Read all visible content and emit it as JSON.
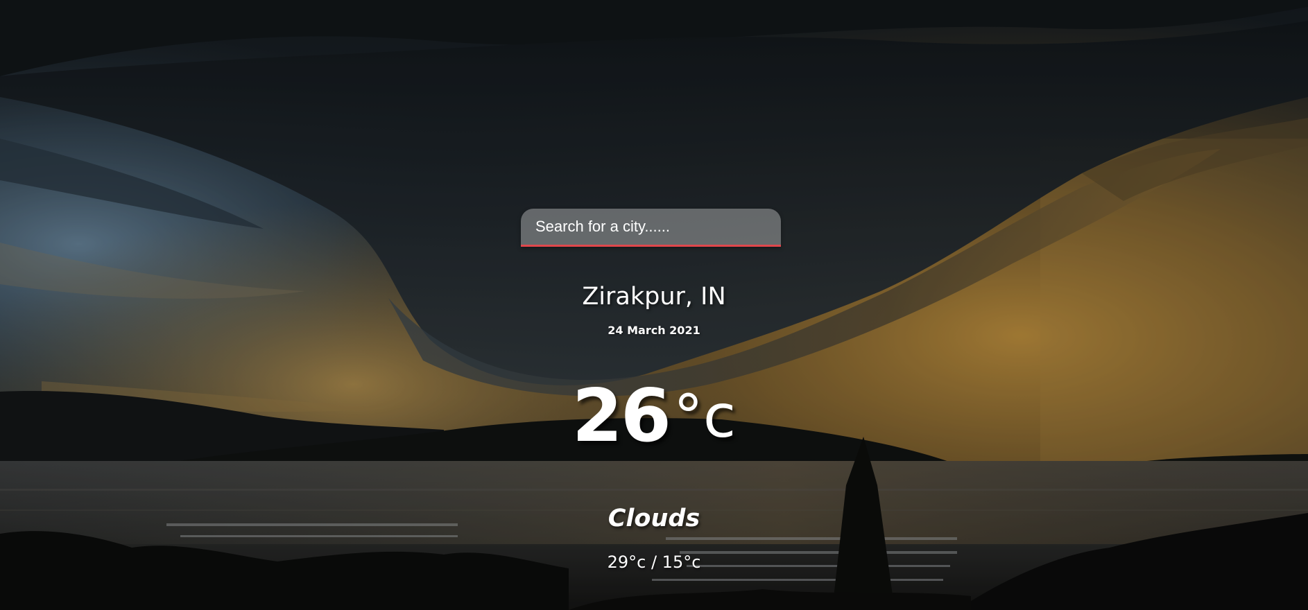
{
  "search": {
    "placeholder": "Search for a city......",
    "underline_color": "#e0474c"
  },
  "location": {
    "city": "Zirakpur, IN",
    "date": "24 March 2021"
  },
  "weather": {
    "temperature": "26",
    "unit": "°c",
    "condition": "Clouds",
    "high_low": "29°c / 15°c"
  },
  "background": {
    "description_icon": "storm-cloud-landscape",
    "sky_dark": "#1c2228",
    "sky_gold": "#b9893c",
    "water": "#3d3f3f"
  }
}
